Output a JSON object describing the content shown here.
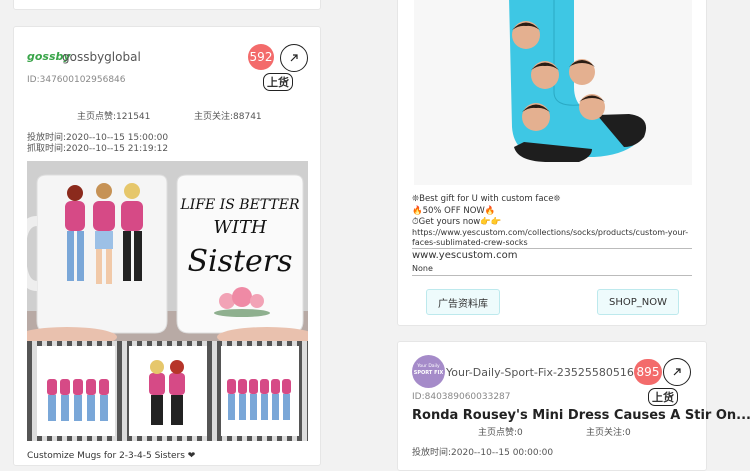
{
  "left_card": {
    "brand_logo_text": "gossby",
    "account_name": "gossbyglobal",
    "ad_id": "ID:347600102956846",
    "count_badge": "592",
    "listed_button": "上货",
    "likes_label": "主页点赞:121541",
    "follows_label": "主页关注:88741",
    "publish_time": "投放时间:2020--10--15 15:00:00",
    "crawl_time": "抓取时间:2020--10--15 21:19:12",
    "mug_text_line1": "LIFE IS BETTER",
    "mug_text_line2": "WITH",
    "mug_text_line3": "Sisters",
    "caption": "Customize Mugs for 2-3-4-5 Sisters ❤"
  },
  "right_card_top": {
    "ad_line1": "❊Best gift for U with custom face❊",
    "ad_line2": "🔥50% OFF NOW🔥",
    "ad_line3": "⏱Get yours now👉👉",
    "ad_url_line1": "https://www.yescustom.com/collections/socks/products/custom-your-",
    "ad_url_line2": "faces-sublimated-crew-socks",
    "domain": "www.yescustom.com",
    "extra": "None",
    "ad_library_button": "广告资料库",
    "shop_now_button": "SHOP_NOW"
  },
  "right_card_bottom": {
    "avatar_line1": "Your Daily",
    "avatar_line2": "SPORT FIX",
    "account_name": "Your-Daily-Sport-Fix-2352558051680",
    "ad_id": "ID:840389060033287",
    "count_badge": "895",
    "listed_button": "上货",
    "headline": "Ronda Rousey's Mini Dress Causes A Stir On...",
    "likes_label": "主页点赞:0",
    "follows_label": "主页关注:0",
    "publish_time": "投放时间:2020--10--15 00:00:00"
  },
  "colors": {
    "badge_red": "#f36b6b",
    "sock_blue": "#3ec7e4",
    "button_bg": "#eefbfc",
    "brand_green": "#3aa54a",
    "avatar_purple": "#a58bc9"
  },
  "icons": {
    "open_link": "arrow-up-right-icon"
  }
}
